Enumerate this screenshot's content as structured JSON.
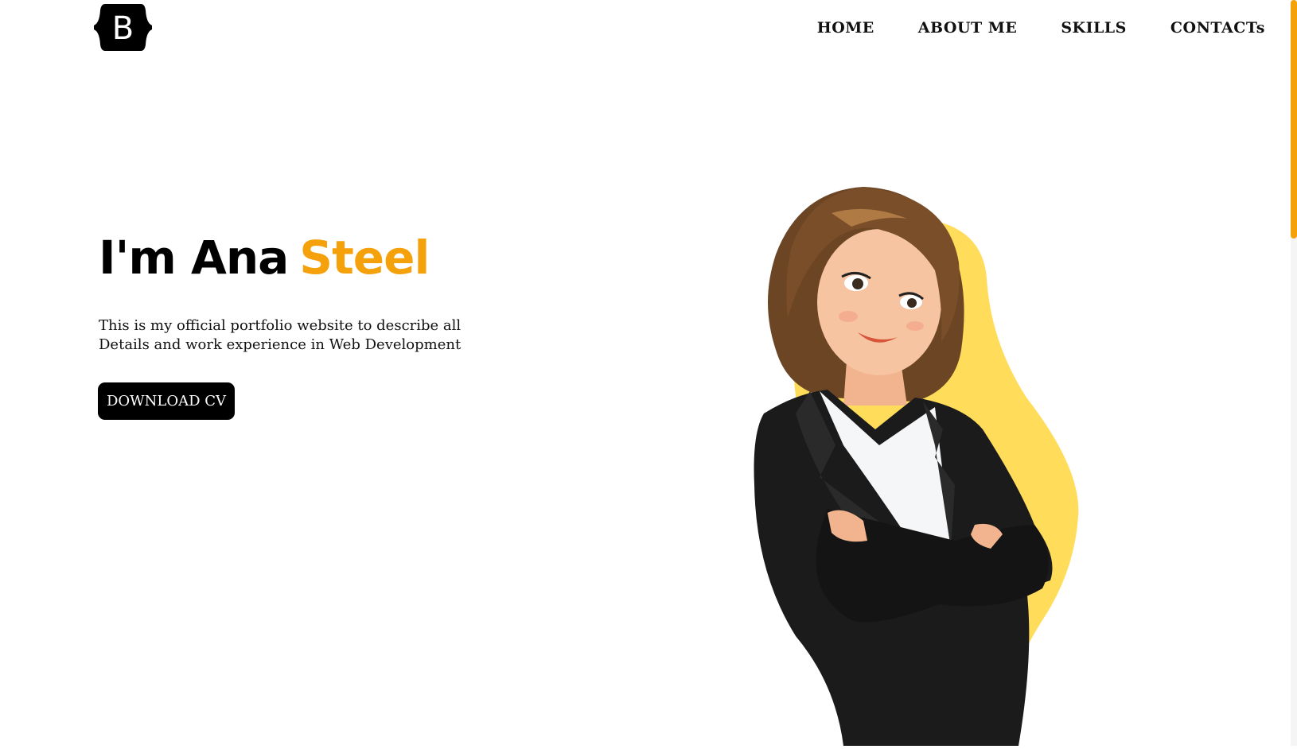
{
  "logo": {
    "letter": "B",
    "icon": "bootstrap-logo-icon"
  },
  "nav": {
    "home": "HOME",
    "about": "ABOUT ME",
    "skills": "SKILLS",
    "contacts": "CONTACTs"
  },
  "hero": {
    "title_prefix": "I'm Ana",
    "title_accent": "Steel",
    "description": "This is my official portfolio website to describe all Details and work experience in Web Development",
    "cta_label": "DOWNLOAD CV"
  },
  "colors": {
    "accent": "#F5A10B",
    "blob": "#FFDC5A",
    "button_bg": "#000000"
  },
  "illustration": {
    "icon": "businesswoman-illustration"
  }
}
